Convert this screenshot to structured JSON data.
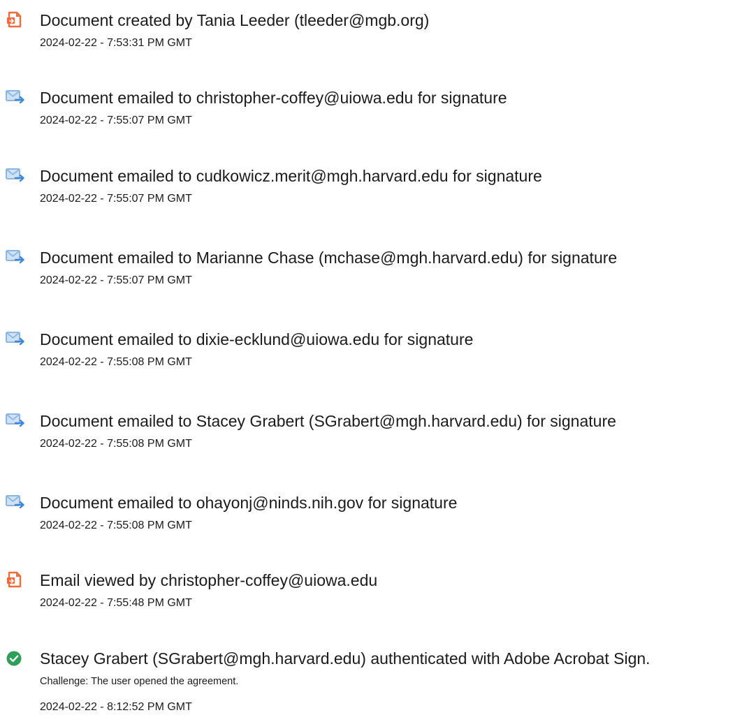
{
  "events": [
    {
      "icon": "document-create-icon",
      "title": "Document created by Tania Leeder (tleeder@mgb.org)",
      "timestamp": "2024-02-22 - 7:53:31 PM GMT"
    },
    {
      "icon": "email-send-icon",
      "title": "Document emailed to christopher-coffey@uiowa.edu for signature",
      "timestamp": "2024-02-22 - 7:55:07 PM GMT"
    },
    {
      "icon": "email-send-icon",
      "title": "Document emailed to cudkowicz.merit@mgh.harvard.edu for signature",
      "timestamp": "2024-02-22 - 7:55:07 PM GMT"
    },
    {
      "icon": "email-send-icon",
      "title": "Document emailed to Marianne Chase (mchase@mgh.harvard.edu) for signature",
      "timestamp": "2024-02-22 - 7:55:07 PM GMT"
    },
    {
      "icon": "email-send-icon",
      "title": "Document emailed to dixie-ecklund@uiowa.edu for signature",
      "timestamp": "2024-02-22 - 7:55:08 PM GMT"
    },
    {
      "icon": "email-send-icon",
      "title": "Document emailed to Stacey Grabert (SGrabert@mgh.harvard.edu) for signature",
      "timestamp": "2024-02-22 - 7:55:08 PM GMT"
    },
    {
      "icon": "email-send-icon",
      "title": "Document emailed to ohayonj@ninds.nih.gov for signature",
      "timestamp": "2024-02-22 - 7:55:08 PM GMT"
    },
    {
      "icon": "document-view-icon",
      "title": "Email viewed by christopher-coffey@uiowa.edu",
      "timestamp": "2024-02-22 - 7:55:48 PM GMT"
    },
    {
      "icon": "check-circle-icon",
      "title": "Stacey Grabert (SGrabert@mgh.harvard.edu) authenticated with Adobe Acrobat Sign.",
      "detail": "Challenge: The user opened the agreement.",
      "timestamp": "2024-02-22 - 8:12:52 PM GMT"
    }
  ],
  "colors": {
    "document_icon": "#f26a3c",
    "email_icon": "#8cb6e3",
    "email_arrow": "#3b86d6",
    "check_icon": "#2e9e58",
    "text": "#1b1b1b"
  }
}
